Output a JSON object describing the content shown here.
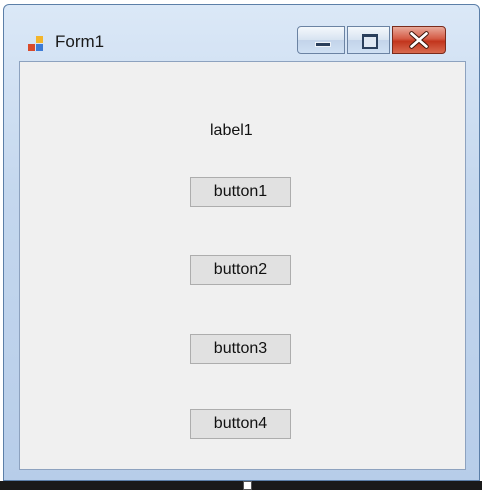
{
  "window": {
    "title": "Form1",
    "icon": "winforms-app-icon",
    "controls": {
      "minimize_icon": "minimize-icon",
      "maximize_icon": "maximize-icon",
      "close_icon": "close-icon"
    }
  },
  "form": {
    "label_text": "label1",
    "buttons": [
      "button1",
      "button2",
      "button3",
      "button4"
    ]
  },
  "colors": {
    "frame": "#b7cde9",
    "client": "#f0f0f0",
    "button_face": "#e1e1e1",
    "close_red": "#c2351d"
  }
}
